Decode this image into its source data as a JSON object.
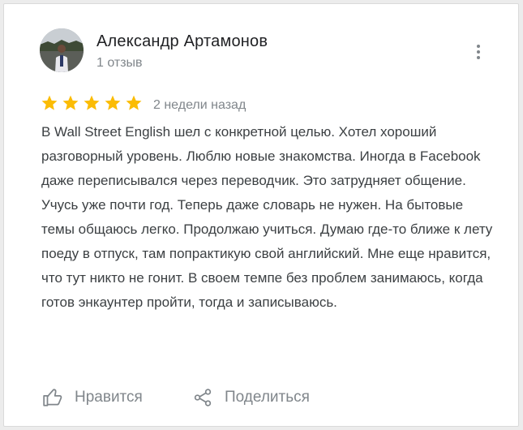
{
  "review": {
    "author": "Александр Артамонов",
    "review_count": "1 отзыв",
    "rating": 5,
    "max_rating": 5,
    "date": "2 недели назад",
    "text": "В Wall Street English шел с конкретной целью. Хотел хороший разговорный уровень. Люблю новые знакомства. Иногда в Facebook даже переписывался через переводчик. Это затрудняет общение. Учусь уже почти год. Теперь даже словарь не нужен. На бытовые темы общаюсь легко. Продолжаю учиться. Думаю где-то ближе к лету поеду в отпуск, там попрактикую свой английский. Мне еще нравится, что тут никто не гонит. В своем темпе без проблем занимаюсь, когда готов энкаунтер пройти, тогда и записываюсь."
  },
  "actions": {
    "like_label": "Нравится",
    "share_label": "Поделиться"
  },
  "colors": {
    "star": "#fbbc04",
    "secondary_text": "#80868b",
    "primary_text": "#202124",
    "body_text": "#3c4043"
  },
  "icons": {
    "more": "more-vert-icon",
    "like": "thumb-up-icon",
    "share": "share-icon",
    "star": "star-icon"
  }
}
